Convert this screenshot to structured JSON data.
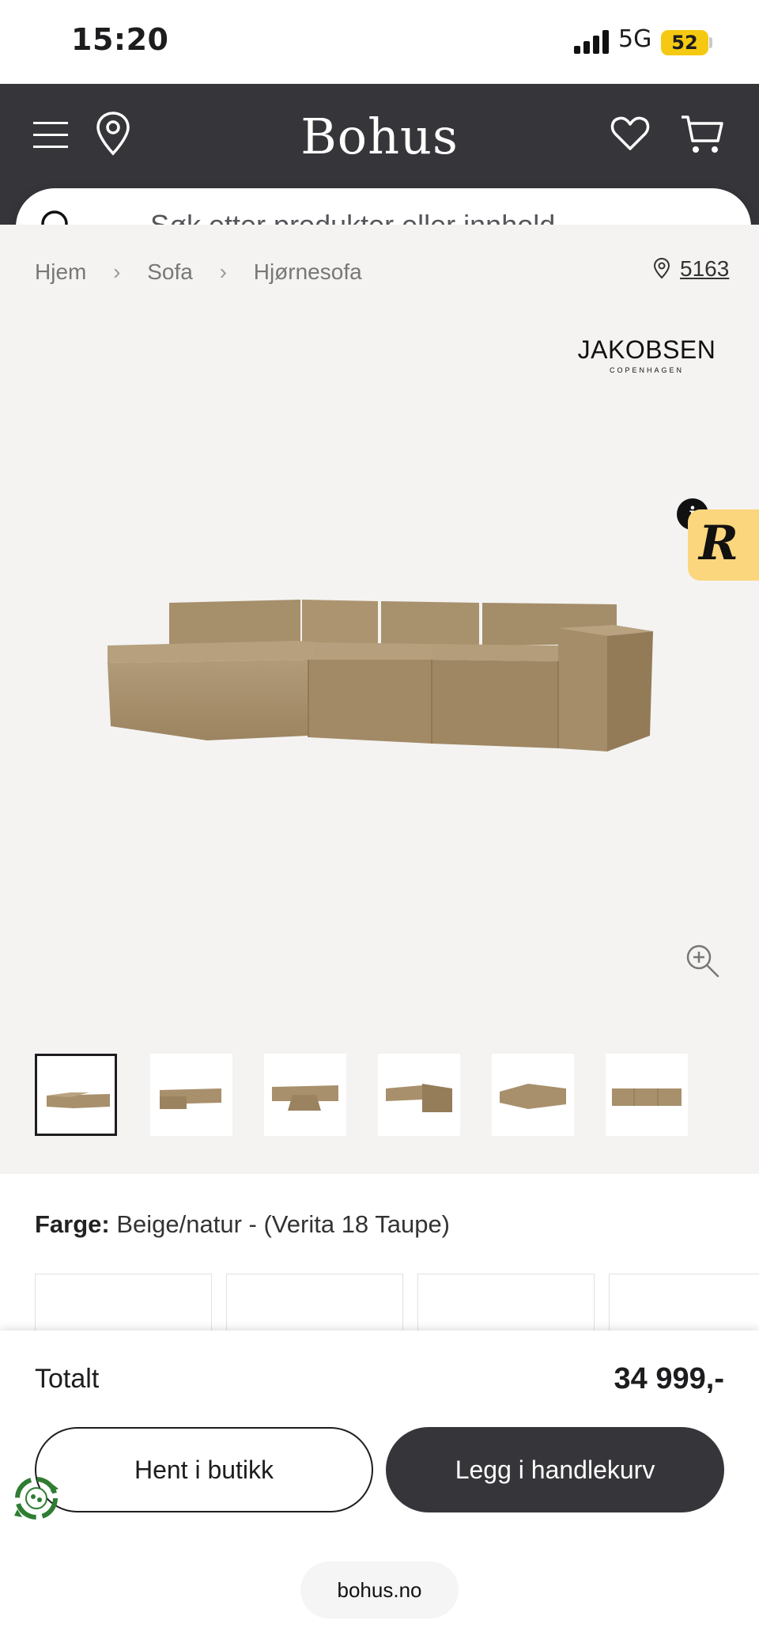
{
  "status_bar": {
    "time": "15:20",
    "network": "5G",
    "battery": "52"
  },
  "header": {
    "logo": "Bohus",
    "icons": [
      "menu-icon",
      "location-pin-icon",
      "heart-icon",
      "cart-icon"
    ]
  },
  "search": {
    "placeholder": "Søk etter produkter eller innhold ..."
  },
  "breadcrumb": {
    "items": [
      "Hjem",
      "Sofa",
      "Hjørnesofa"
    ]
  },
  "store": {
    "label": "5163"
  },
  "brand": {
    "name": "JAKOBSEN",
    "sub": "COPENHAGEN"
  },
  "badge": {
    "letter": "R",
    "info": "i"
  },
  "gallery": {
    "thumbnail_count": 6,
    "active_index": 0
  },
  "color": {
    "label": "Farge:",
    "value": "Beige/natur - (Verita 18 Taupe)"
  },
  "purchase": {
    "total_label": "Totalt",
    "price": "34 999,-",
    "pickup_button": "Hent i butikk",
    "cart_button": "Legg i handlekurv"
  },
  "browser": {
    "url": "bohus.no"
  },
  "colors": {
    "header_bg": "#36363a",
    "hero_bg": "#f4f3f2",
    "sofa": "#a8906c",
    "badge": "#fcd67c",
    "battery": "#f5c911"
  }
}
